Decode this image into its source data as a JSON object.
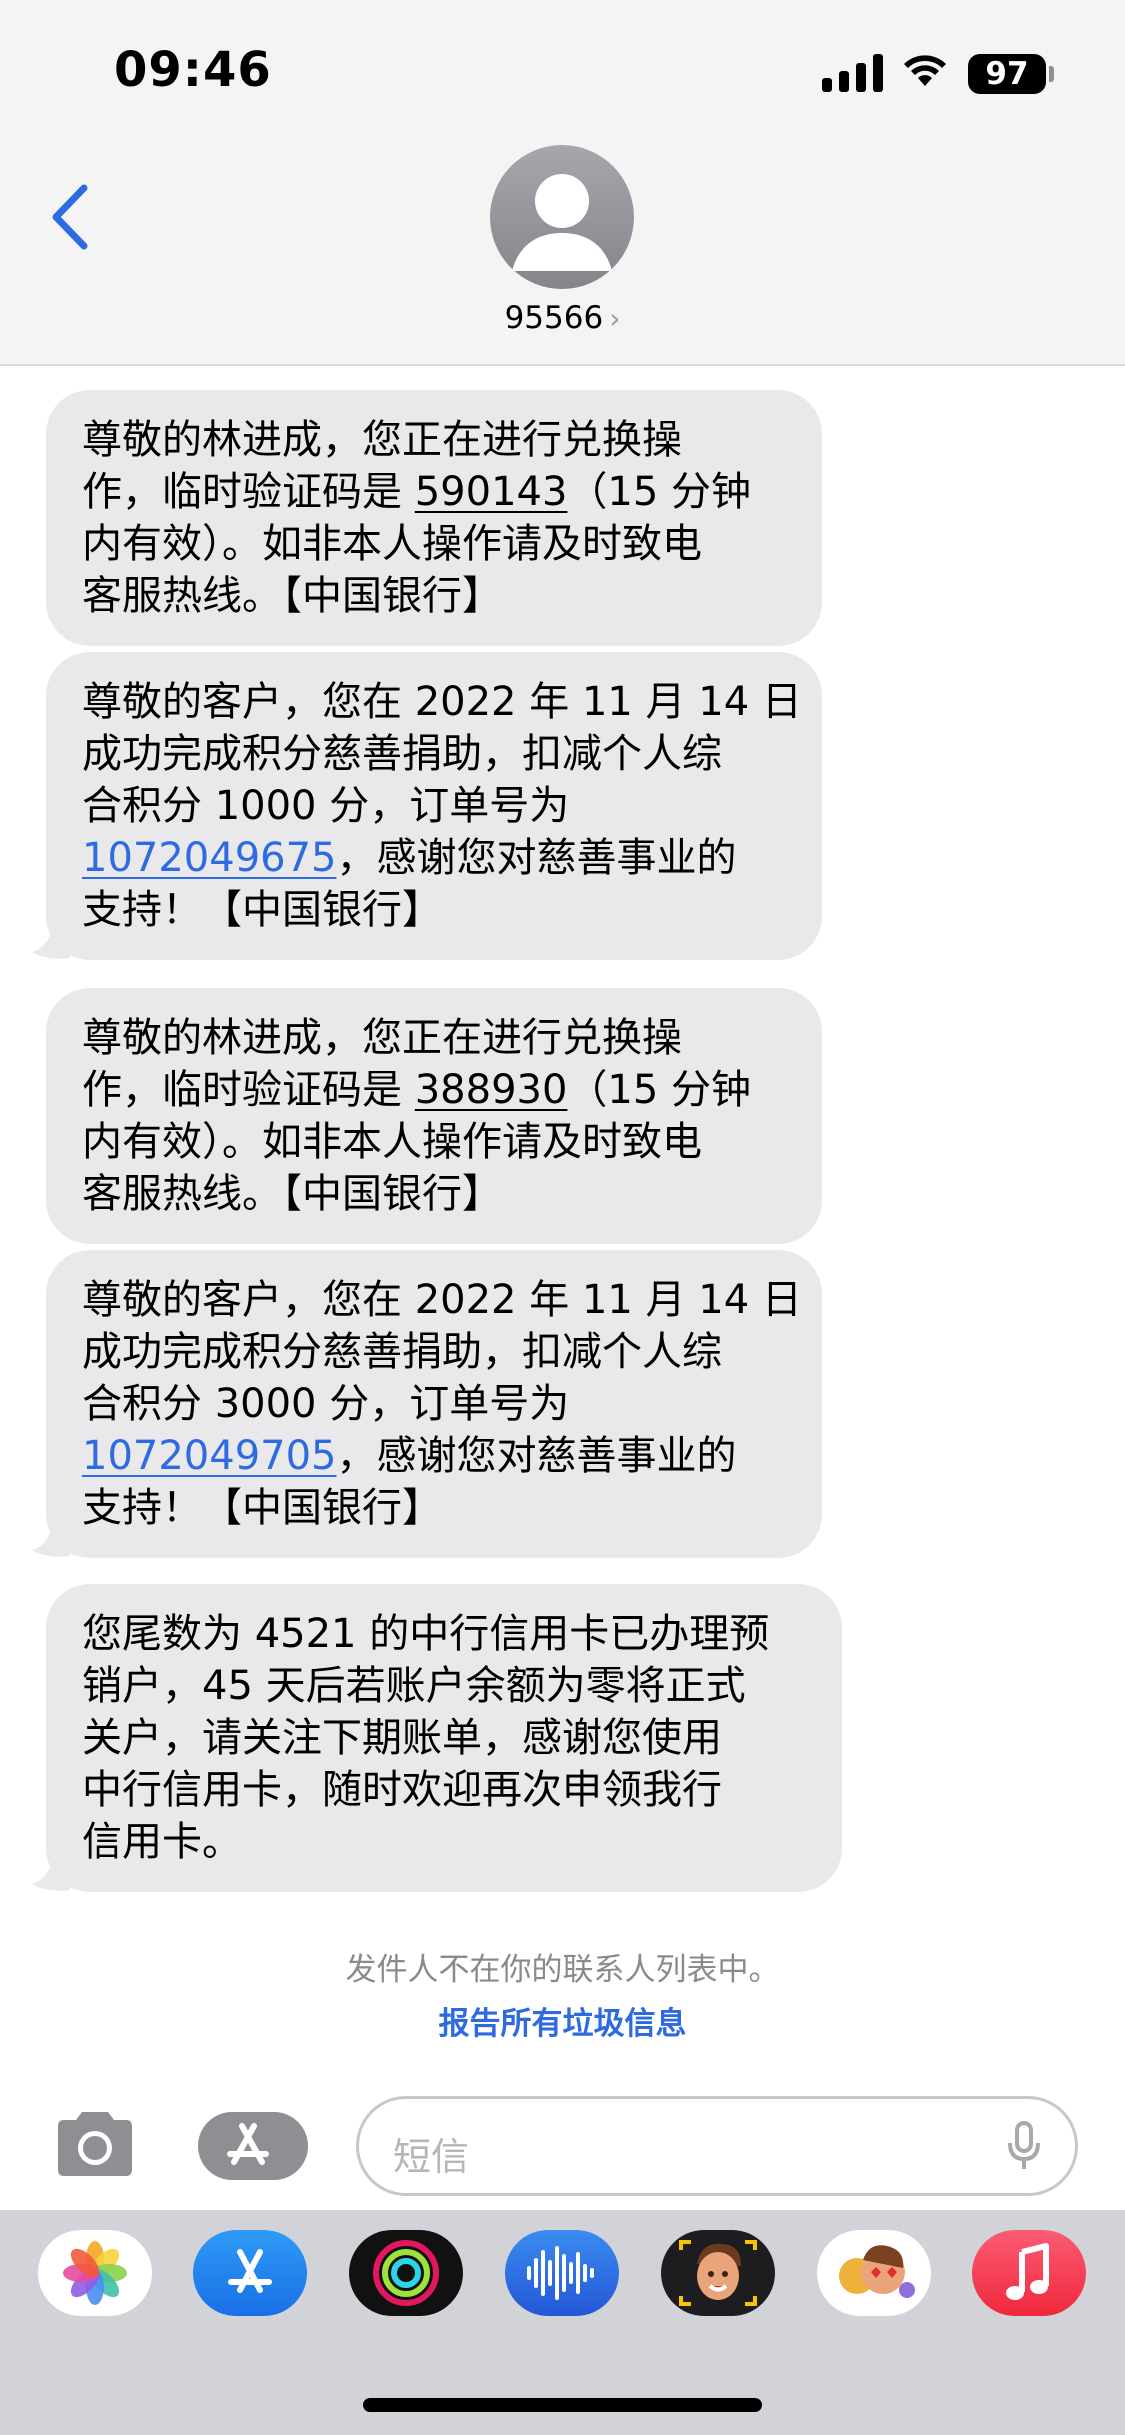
{
  "status_bar": {
    "time": "09:46",
    "battery": "97"
  },
  "contact": {
    "name": "95566",
    "chevron": "›"
  },
  "messages": [
    {
      "lines": [
        "尊敬的林进成，您正在进行兑换操",
        "作，临时验证码是 ",
        "590143",
        "（15 分钟",
        "内有效）。如非本人操作请及时致电",
        "客服热线。【中国银行】"
      ]
    },
    {
      "lines": [
        "尊敬的客户，您在 2022 年 11 月 14 日",
        "成功完成积分慈善捐助，扣减个人综",
        "合积分 1000 分，订单号为",
        "1072049675",
        "，感谢您对慈善事业的",
        "支持！【中国银行】"
      ]
    },
    {
      "lines": [
        "尊敬的林进成，您正在进行兑换操",
        "作，临时验证码是 ",
        "388930",
        "（15 分钟",
        "内有效）。如非本人操作请及时致电",
        "客服热线。【中国银行】"
      ]
    },
    {
      "lines": [
        "尊敬的客户，您在 2022 年 11 月 14 日",
        "成功完成积分慈善捐助，扣减个人综",
        "合积分 3000 分，订单号为",
        "1072049705",
        "，感谢您对慈善事业的",
        "支持！【中国银行】"
      ]
    },
    {
      "lines": [
        "您尾数为 4521 的中行信用卡已办理预",
        "销户，45 天后若账户余额为零将正式",
        "关户，请关注下期账单，感谢您使用",
        "中行信用卡，随时欢迎再次申领我行",
        "信用卡。"
      ]
    }
  ],
  "notice": {
    "not_in_contacts": "发件人不在你的联系人列表中。",
    "report_junk": "报告所有垃圾信息"
  },
  "input": {
    "placeholder": "短信"
  },
  "app_drawer": [
    "photos-icon",
    "app-store-icon",
    "activity-icon",
    "voice-memo-icon",
    "memoji-icon",
    "animoji-stickers-icon",
    "music-icon"
  ],
  "colors": {
    "bubble": "#e9e9eb",
    "link": "#2e6be0",
    "header_bg": "#f4f4f5",
    "drawer_bg": "#d1d3d9"
  }
}
